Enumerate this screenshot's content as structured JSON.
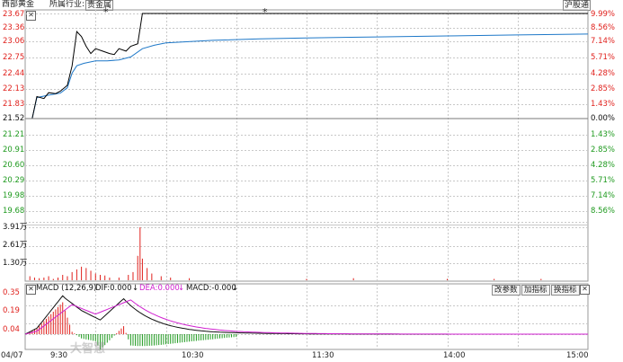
{
  "header": {
    "stock_name": "西部黄金",
    "industry_label": "所属行业:",
    "industry_value": "贵金属",
    "board_label": "沪股通"
  },
  "price_axis": {
    "left_labels": [
      "23.67",
      "23.36",
      "23.06",
      "22.75",
      "22.44",
      "22.13",
      "21.83",
      "21.52",
      "21.21",
      "20.91",
      "20.60",
      "20.29",
      "19.98",
      "19.68"
    ],
    "right_labels": [
      "9.99%",
      "8.56%",
      "7.14%",
      "5.71%",
      "4.28%",
      "2.85%",
      "1.43%",
      "0.00%",
      "1.43%",
      "2.85%",
      "4.28%",
      "5.71%",
      "7.14%",
      "8.56%"
    ],
    "prev_close": 21.52
  },
  "volume_axis": {
    "labels": [
      "3.91万",
      "2.61万",
      "1.30万"
    ]
  },
  "macd_panel": {
    "title": "MACD (12,26,9)",
    "dif_label": "DIF:0.000",
    "dea_label": "DEA:0.000",
    "macd_label": "MACD:-0.000",
    "buttons": [
      "改参数",
      "加指标",
      "换指标"
    ],
    "axis_labels": [
      "0.35",
      "0.19",
      "0.04"
    ]
  },
  "time_axis": {
    "date": "04/07",
    "labels": [
      "9:30",
      "10:30",
      "11:30",
      "14:00",
      "15:00"
    ]
  },
  "markers": [
    "*",
    "*"
  ],
  "watermark": "大智慧",
  "colors": {
    "up": "#e0211d",
    "down": "#1f9a1f",
    "price_line": "#000000",
    "avg_line": "#1e78c8",
    "dif_line": "#111111",
    "dea_line": "#d020d0",
    "grid": "#c8c8c8"
  },
  "chart_data": {
    "type": "line",
    "x_range": [
      "9:30",
      "15:00"
    ],
    "series": [
      {
        "x": [
          0,
          3,
          5,
          8,
          10,
          13,
          15,
          18,
          20,
          22,
          24,
          26,
          28,
          30,
          33,
          36,
          38,
          40,
          43,
          45,
          48,
          50,
          52,
          55,
          240
        ],
        "values": [
          21.52,
          21.52,
          21.97,
          21.93,
          22.05,
          22.03,
          22.08,
          22.2,
          22.6,
          23.3,
          23.2,
          23.0,
          22.85,
          22.95,
          22.9,
          22.85,
          22.83,
          22.95,
          22.9,
          23.0,
          23.05,
          23.67,
          23.67,
          23.67,
          23.67
        ]
      },
      {
        "x": [
          0,
          3,
          5,
          10,
          15,
          18,
          20,
          22,
          25,
          30,
          35,
          40,
          45,
          50,
          55,
          60,
          80,
          100,
          120,
          150,
          180,
          210,
          240
        ],
        "values": [
          21.52,
          21.52,
          21.95,
          22.0,
          22.04,
          22.15,
          22.45,
          22.6,
          22.65,
          22.7,
          22.7,
          22.72,
          22.78,
          22.95,
          23.02,
          23.07,
          23.12,
          23.15,
          23.17,
          23.19,
          23.21,
          23.23,
          23.25
        ]
      }
    ],
    "volume": {
      "x": [
        2,
        4,
        6,
        8,
        10,
        12,
        14,
        16,
        18,
        20,
        22,
        24,
        26,
        28,
        30,
        32,
        34,
        36,
        40,
        44,
        46,
        48,
        49,
        50,
        52,
        54,
        58,
        62,
        70,
        120,
        140,
        180,
        200,
        220
      ],
      "values": [
        0.3,
        0.2,
        0.15,
        0.2,
        0.3,
        0.1,
        0.2,
        0.4,
        0.3,
        0.6,
        0.8,
        1.0,
        0.9,
        0.7,
        0.5,
        0.4,
        0.35,
        0.2,
        0.2,
        0.4,
        0.6,
        1.8,
        3.91,
        1.6,
        0.9,
        0.5,
        0.3,
        0.2,
        0.15,
        0.1,
        0.15,
        0.1,
        0.1,
        0.1
      ]
    }
  }
}
